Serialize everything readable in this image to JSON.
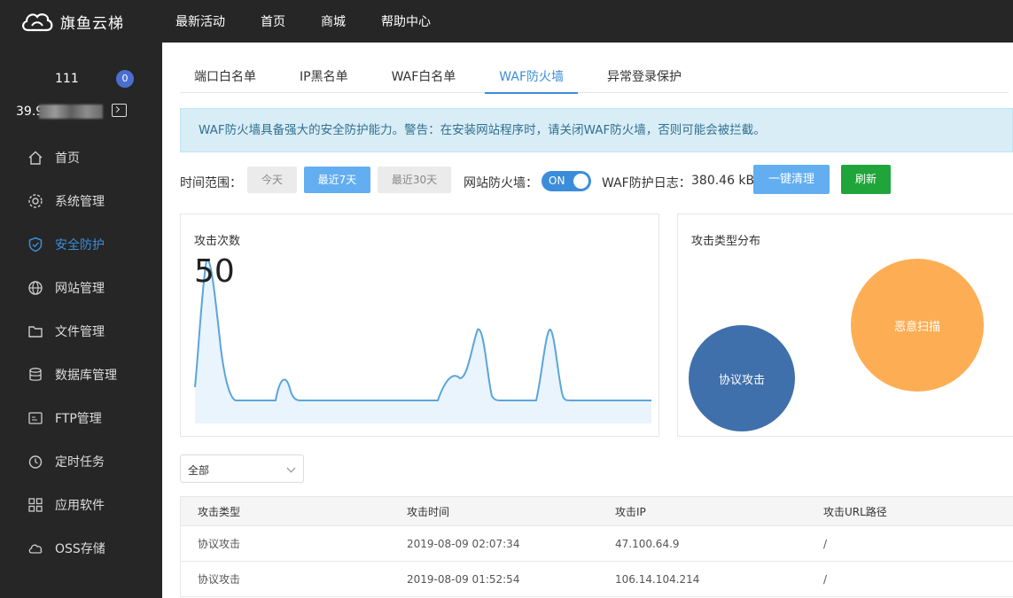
{
  "app": {
    "logo_text": "旗鱼云梯"
  },
  "topnav": [
    "最新活动",
    "首页",
    "商城",
    "帮助中心"
  ],
  "user": {
    "name": "111",
    "badge": "0",
    "ip_prefix": "39.9"
  },
  "sidebar": {
    "items": [
      {
        "label": "首页",
        "icon": "home-icon"
      },
      {
        "label": "系统管理",
        "icon": "gear-icon"
      },
      {
        "label": "安全防护",
        "icon": "shield-icon"
      },
      {
        "label": "网站管理",
        "icon": "globe-icon"
      },
      {
        "label": "文件管理",
        "icon": "folder-icon"
      },
      {
        "label": "数据库管理",
        "icon": "database-icon"
      },
      {
        "label": "FTP管理",
        "icon": "ftp-icon"
      },
      {
        "label": "定时任务",
        "icon": "clock-icon"
      },
      {
        "label": "应用软件",
        "icon": "apps-icon"
      },
      {
        "label": "OSS存储",
        "icon": "cloud-storage-icon"
      }
    ],
    "active_index": 2
  },
  "tabs": [
    "端口白名单",
    "IP黑名单",
    "WAF白名单",
    "WAF防火墙",
    "异常登录保护"
  ],
  "active_tab": 3,
  "notice": "WAF防火墙具备强大的安全防护能力。警告：在安装网站程序时，请关闭WAF防火墙，否则可能会被拦截。",
  "controls": {
    "time_range_label": "时间范围：",
    "ranges": [
      "今天",
      "最近7天",
      "最近30天"
    ],
    "active_range": 1,
    "firewall_label": "网站防火墙：",
    "toggle_text": "ON",
    "log_label": "WAF防护日志：",
    "log_size": "380.46 kB",
    "clear_button": "一键清理",
    "refresh_button": "刷新"
  },
  "attack_count": {
    "title": "攻击次数",
    "value": "50"
  },
  "attack_types": {
    "title": "攻击类型分布",
    "bubbles": [
      {
        "label": "协议攻击",
        "color": "#3f70ac"
      },
      {
        "label": "恶意扫描",
        "color": "#fdae55"
      }
    ]
  },
  "colors": {
    "accent": "#3c8dd9",
    "chart_line": "#5aa5da",
    "chart_fill": "#eaf4fc",
    "green": "#20a53a"
  },
  "filter": {
    "selected": "全部"
  },
  "table": {
    "headers": [
      "攻击类型",
      "攻击时间",
      "攻击IP",
      "攻击URL路径"
    ],
    "rows": [
      [
        "协议攻击",
        "2019-08-09 02:07:34",
        "47.100.64.9",
        "/"
      ],
      [
        "协议攻击",
        "2019-08-09 01:52:54",
        "106.14.104.214",
        "/"
      ]
    ]
  }
}
